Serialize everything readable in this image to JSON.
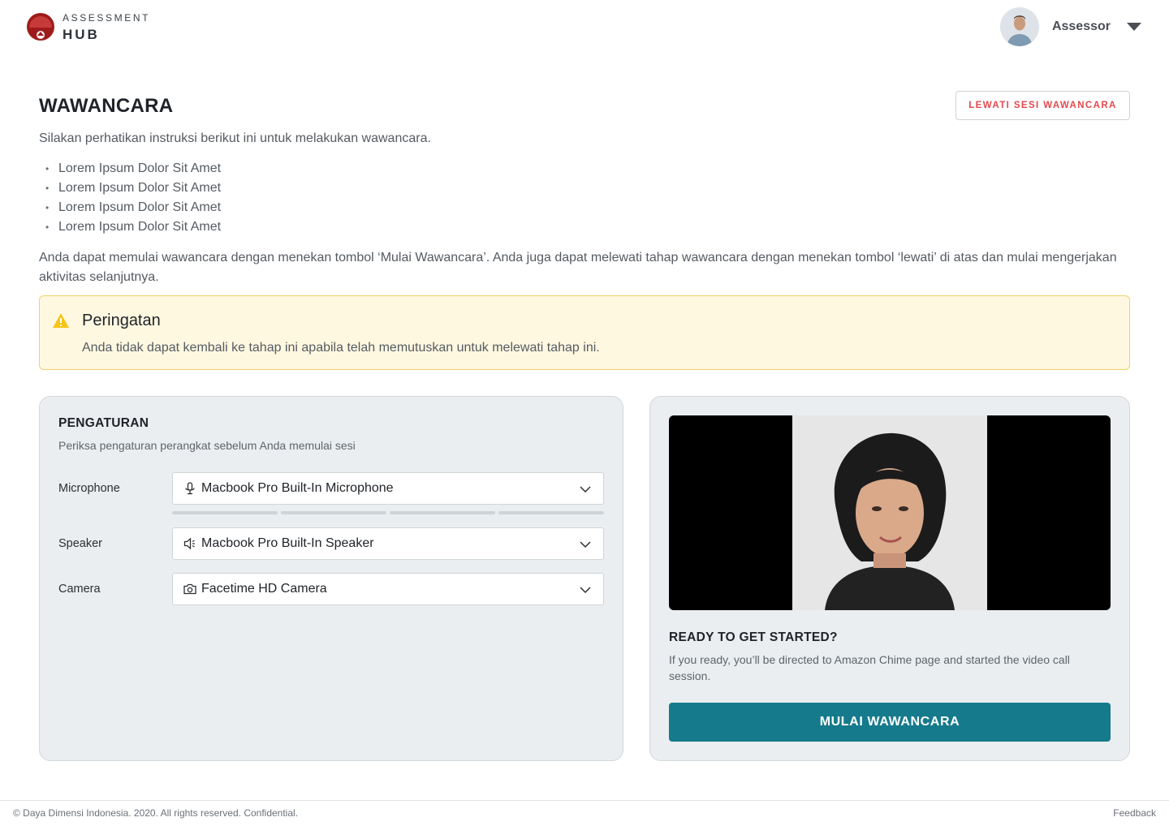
{
  "header": {
    "logo_top": "ASSESSMENT",
    "logo_bottom": "HUB",
    "user_name": "Assessor"
  },
  "main": {
    "title": "WAWANCARA",
    "skip_label": "LEWATI SESI WAWANCARA",
    "intro": "Silakan perhatikan instruksi berikut ini untuk melakukan wawancara.",
    "instructions": [
      "Lorem Ipsum Dolor Sit Amet",
      "Lorem Ipsum Dolor Sit Amet",
      "Lorem Ipsum Dolor Sit Amet",
      "Lorem Ipsum Dolor Sit Amet"
    ],
    "description": "Anda dapat memulai wawancara dengan menekan tombol ‘Mulai Wawancara’. Anda juga dapat melewati tahap wawancara dengan menekan tombol ‘lewati’ di atas dan mulai mengerjakan aktivitas selanjutnya."
  },
  "warning": {
    "title": "Peringatan",
    "text": "Anda tidak dapat kembali ke tahap ini apabila telah memutuskan untuk melewati tahap ini.",
    "color": "#f5c518"
  },
  "settings": {
    "title": "PENGATURAN",
    "subtitle": "Periksa pengaturan perangkat sebelum Anda memulai sesi",
    "microphone": {
      "label": "Microphone",
      "value": "Macbook Pro Built-In Microphone",
      "icon": "microphone-icon"
    },
    "mic_level": 0,
    "speaker": {
      "label": "Speaker",
      "value": "Macbook Pro Built-In Speaker",
      "icon": "speaker-icon"
    },
    "camera": {
      "label": "Camera",
      "value": "Facetime HD Camera",
      "icon": "camera-icon"
    }
  },
  "video": {
    "ready_title": "READY TO GET STARTED?",
    "ready_text": "If you ready, you’ll be directed to Amazon Chime page and started the video call session.",
    "start_label": "MULAI WAWANCARA",
    "accent": "#157a8c"
  },
  "footer": {
    "copyright": "© Daya Dimensi Indonesia. 2020. All rights reserved. Confidential.",
    "feedback": "Feedback"
  }
}
